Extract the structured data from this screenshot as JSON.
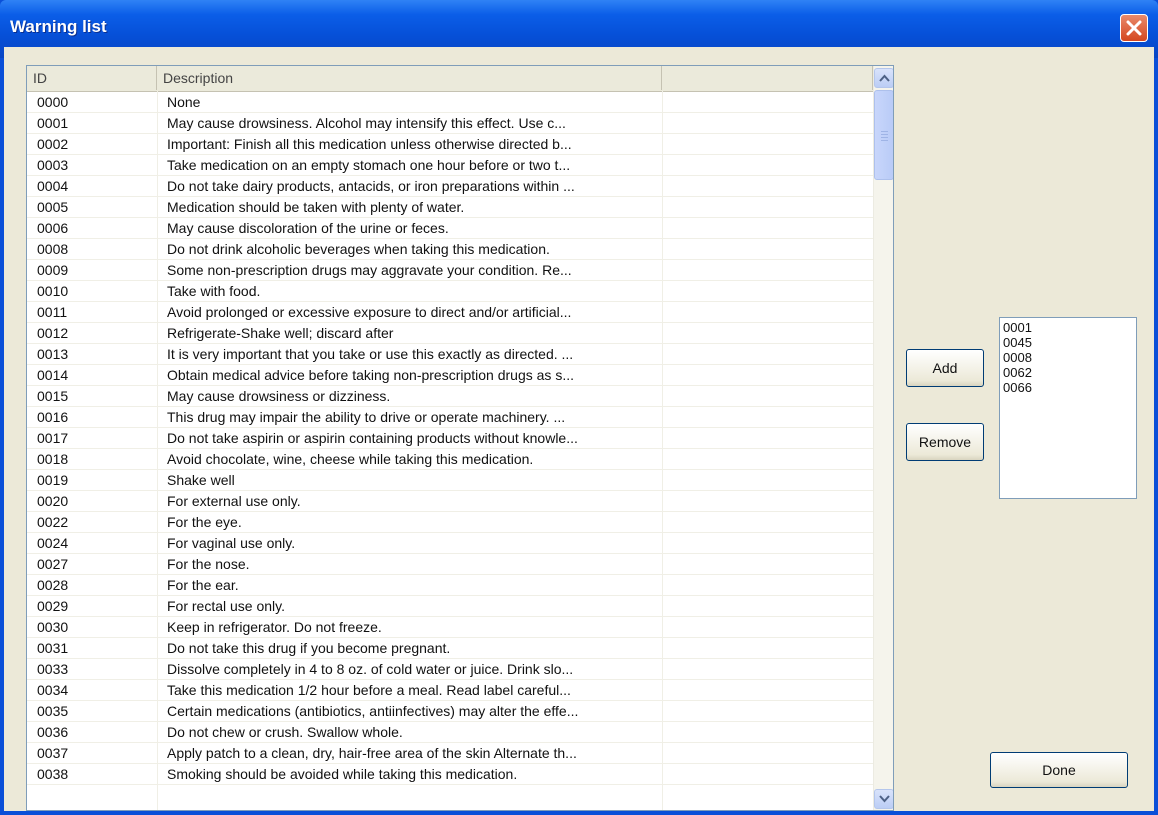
{
  "window": {
    "title": "Warning list"
  },
  "list": {
    "columns": [
      "ID",
      "Description",
      ""
    ],
    "rows": [
      {
        "id": "0000",
        "desc": "None"
      },
      {
        "id": "0001",
        "desc": "May cause drowsiness.  Alcohol may intensify this effect.  Use c..."
      },
      {
        "id": "0002",
        "desc": "Important:  Finish all this medication unless otherwise directed b..."
      },
      {
        "id": "0003",
        "desc": "Take medication on an empty stomach one hour before or two t..."
      },
      {
        "id": "0004",
        "desc": "Do not take dairy products, antacids, or iron preparations within ..."
      },
      {
        "id": "0005",
        "desc": "Medication should be taken with plenty of water."
      },
      {
        "id": "0006",
        "desc": "May cause discoloration of the urine or feces."
      },
      {
        "id": "0008",
        "desc": "Do not drink alcoholic beverages when taking this medication."
      },
      {
        "id": "0009",
        "desc": "Some non-prescription drugs may aggravate your condition.  Re..."
      },
      {
        "id": "0010",
        "desc": "Take with food."
      },
      {
        "id": "0011",
        "desc": "Avoid prolonged or excessive exposure to direct and/or artificial..."
      },
      {
        "id": "0012",
        "desc": "Refrigerate-Shake well; discard after"
      },
      {
        "id": "0013",
        "desc": "It is very important that you take or use this exactly as directed.  ..."
      },
      {
        "id": "0014",
        "desc": "Obtain medical advice before taking non-prescription drugs as s..."
      },
      {
        "id": "0015",
        "desc": "May cause drowsiness or dizziness."
      },
      {
        "id": "0016",
        "desc": "This drug may impair the ability to drive or operate machinery.  ..."
      },
      {
        "id": "0017",
        "desc": "Do not take aspirin or aspirin containing products without knowle..."
      },
      {
        "id": "0018",
        "desc": "Avoid chocolate, wine, cheese while taking this medication."
      },
      {
        "id": "0019",
        "desc": "Shake well"
      },
      {
        "id": "0020",
        "desc": "For external use only."
      },
      {
        "id": "0022",
        "desc": "For the eye."
      },
      {
        "id": "0024",
        "desc": "For vaginal use only."
      },
      {
        "id": "0027",
        "desc": "For the nose."
      },
      {
        "id": "0028",
        "desc": "For the ear."
      },
      {
        "id": "0029",
        "desc": "For rectal use only."
      },
      {
        "id": "0030",
        "desc": "Keep in refrigerator.  Do not freeze."
      },
      {
        "id": "0031",
        "desc": "Do not take this drug if you become pregnant."
      },
      {
        "id": "0033",
        "desc": "Dissolve completely in 4 to 8 oz. of cold water or juice.  Drink slo..."
      },
      {
        "id": "0034",
        "desc": "Take this medication 1/2 hour before a meal.  Read label careful..."
      },
      {
        "id": "0035",
        "desc": "Certain medications (antibiotics, antiinfectives) may alter the effe..."
      },
      {
        "id": "0036",
        "desc": "Do not chew or crush.  Swallow whole."
      },
      {
        "id": "0037",
        "desc": "Apply patch to a clean, dry, hair-free area of the skin Alternate th..."
      },
      {
        "id": "0038",
        "desc": "Smoking should be avoided while taking this medication."
      }
    ]
  },
  "buttons": {
    "add": "Add",
    "remove": "Remove",
    "done": "Done"
  },
  "selected": [
    "0001",
    "0045",
    "0008",
    "0062",
    "0066"
  ],
  "icons": {
    "close": "close-x-icon",
    "scroll_up": "chevron-up-icon",
    "scroll_down": "chevron-down-icon"
  },
  "colors": {
    "titlebar": "#0a58e0",
    "close": "#d4471f",
    "dialog_bg": "#ece9d8"
  }
}
